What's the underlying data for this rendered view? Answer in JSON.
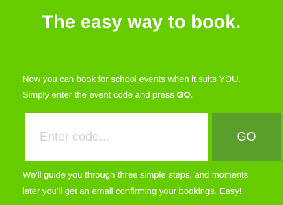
{
  "booking": {
    "headline": "The easy way to book.",
    "intro_line1": "Now you can book for school events when it suits YOU.",
    "intro_line2_prefix": "Simply enter the event code and press ",
    "intro_line2_bold": "GO",
    "intro_line2_suffix": ".",
    "code_placeholder": "Enter code...",
    "code_value": "",
    "go_label": "GO",
    "outro_line1": "We'll guide you through three simple steps, and moments",
    "outro_line2": "later you'll get an email confirming your bookings. Easy!"
  },
  "colors": {
    "background": "#66cc00",
    "button": "#5a9e2b",
    "text": "#ffffff",
    "input_bg": "#ffffff",
    "placeholder": "#d2d2d2"
  }
}
